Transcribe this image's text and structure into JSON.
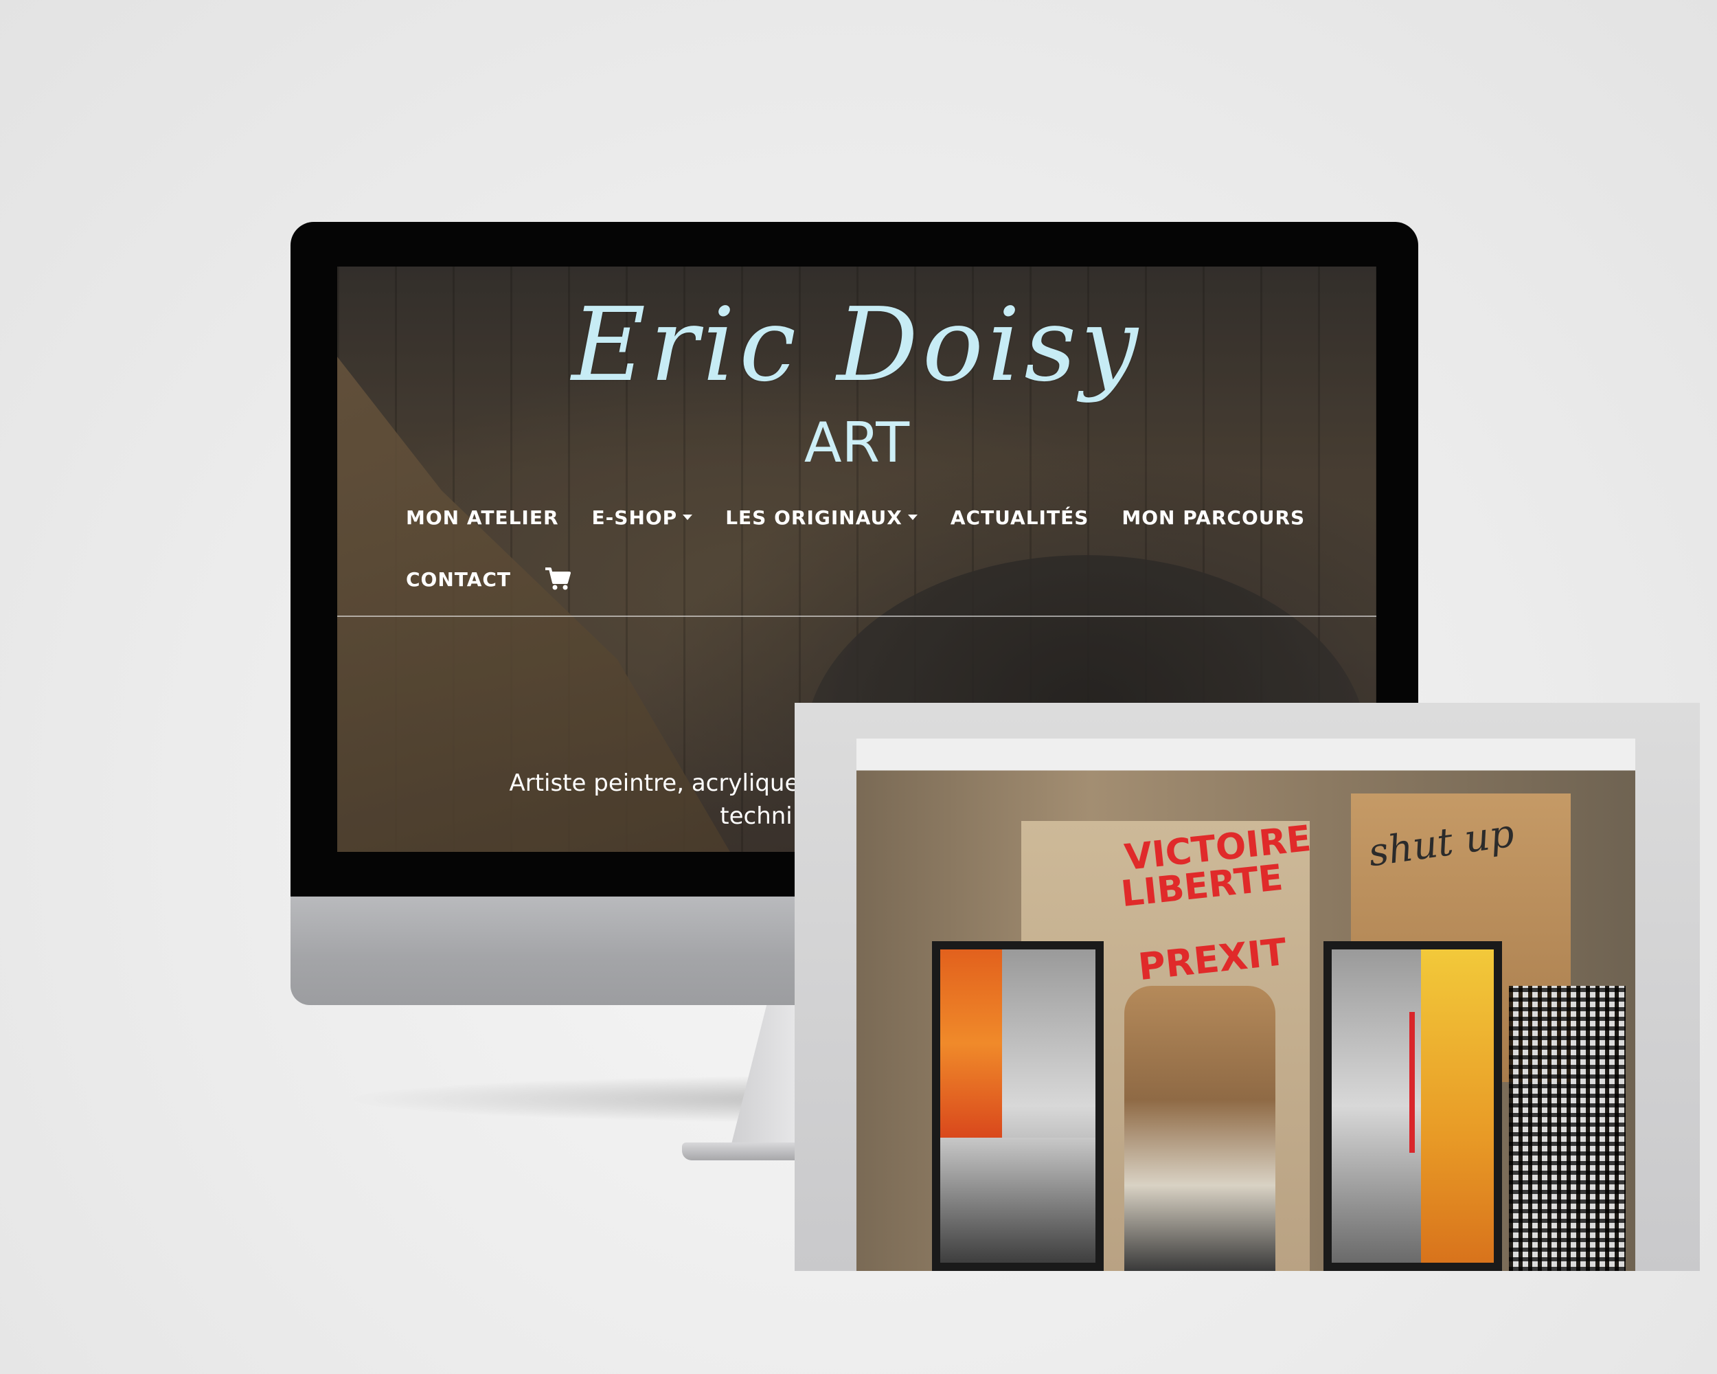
{
  "site": {
    "logo_name": "Eric Doisy",
    "logo_sub": "ART"
  },
  "nav": {
    "row1": [
      {
        "label": "MON ATELIER",
        "dropdown": false
      },
      {
        "label": "E-SHOP",
        "dropdown": true
      },
      {
        "label": "LES ORIGINAUX",
        "dropdown": true
      },
      {
        "label": "ACTUALITÉS",
        "dropdown": false
      },
      {
        "label": "MON PARCOURS",
        "dropdown": false
      }
    ],
    "row2": [
      {
        "label": "CONTACT",
        "dropdown": false
      }
    ],
    "cart_icon": "shopping-cart-icon"
  },
  "hero": {
    "tagline_line1": "Artiste peintre, acrylique, bom",
    "tagline_line2": "techni"
  },
  "photo": {
    "sign_text_1": "VICTOIRE",
    "sign_text_2": "LIBERTE",
    "sign_text_3": "PREXIT",
    "script_text": "shut up"
  },
  "colors": {
    "logo": "#c7ecf5",
    "nav_text": "#ffffff",
    "bezel": "#050505",
    "chin": "#a4a5a8"
  }
}
